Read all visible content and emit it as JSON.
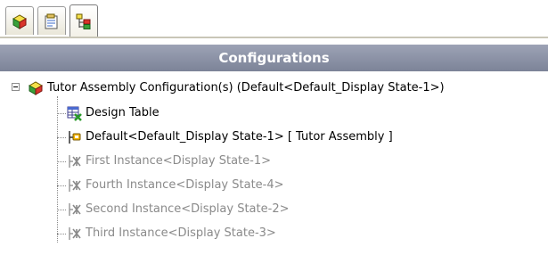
{
  "tabs": [
    {
      "icon": "feature-manager-icon"
    },
    {
      "icon": "property-manager-icon"
    },
    {
      "icon": "configuration-manager-icon"
    }
  ],
  "panel": {
    "title": "Configurations"
  },
  "tree": {
    "root": {
      "label": "Tutor Assembly Configuration(s)  (Default<Default_Display State-1>)",
      "icon": "assembly-config-icon"
    },
    "items": [
      {
        "label": "Design Table",
        "icon": "design-table-icon",
        "greyed": false
      },
      {
        "label": "Default<Default_Display State-1> [ Tutor Assembly ]",
        "icon": "active-config-icon",
        "greyed": false
      },
      {
        "label": "First Instance<Display State-1>",
        "icon": "config-icon",
        "greyed": true
      },
      {
        "label": "Fourth Instance<Display State-4>",
        "icon": "config-icon",
        "greyed": true
      },
      {
        "label": "Second Instance<Display State-2>",
        "icon": "config-icon",
        "greyed": true
      },
      {
        "label": "Third Instance<Display State-3>",
        "icon": "config-icon",
        "greyed": true
      }
    ]
  },
  "colors": {
    "header_bg": "#8b91a6",
    "greyed_text": "#8a8a8a"
  }
}
